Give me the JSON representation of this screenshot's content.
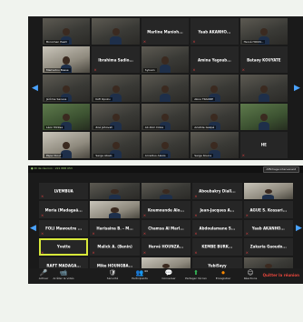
{
  "top_grid": [
    {
      "name": "Bonomen Pesih",
      "style": "video"
    },
    {
      "name": "",
      "style": "video"
    },
    {
      "name": "Marline  Manioh...",
      "style": "blank"
    },
    {
      "name": "Yaab AKANHO...",
      "style": "blank"
    },
    {
      "name": "Hervé HOUN...",
      "style": "video"
    },
    {
      "name": "Mamadou Basse",
      "style": "video light"
    },
    {
      "name": "Ibrahima  Sadio...",
      "style": "blank"
    },
    {
      "name": "Sylvain",
      "style": "video"
    },
    {
      "name": "Amina  Yagoub...",
      "style": "blank"
    },
    {
      "name": "Bataoy KOUYATE",
      "style": "blank"
    },
    {
      "name": "Jérôme Sansoa",
      "style": "video"
    },
    {
      "name": "Kofi Opoku",
      "style": "video"
    },
    {
      "name": "",
      "style": "video"
    },
    {
      "name": "Abou TRAORE",
      "style": "video"
    },
    {
      "name": "",
      "style": "video"
    },
    {
      "name": "Léon Mintsa",
      "style": "video green"
    },
    {
      "name": "Zoé Jéhovah",
      "style": "video"
    },
    {
      "name": "Ali Ahm Doka",
      "style": "video"
    },
    {
      "name": "Aristide Gakpé",
      "style": "video"
    },
    {
      "name": "",
      "style": "video green"
    },
    {
      "name": "Papa Diouf",
      "style": "video light"
    },
    {
      "name": "Serge Abalo",
      "style": "video"
    },
    {
      "name": "Arcadius Alexis",
      "style": "video"
    },
    {
      "name": "Serge Kouna",
      "style": "video"
    },
    {
      "name": "HE",
      "style": "blank"
    }
  ],
  "bottom_strip": {
    "info": "● ID de réunion : 221 888 053",
    "view_button": "Affichage intervenant"
  },
  "bottom_grid": [
    {
      "name": "LVEMBUA",
      "style": "blank"
    },
    {
      "name": "",
      "style": "video"
    },
    {
      "name": "",
      "style": "video"
    },
    {
      "name": "Aboubakry  Diall...",
      "style": "blank"
    },
    {
      "name": "",
      "style": "video light"
    },
    {
      "name": "Moria  (Madagaâ...",
      "style": "blank"
    },
    {
      "name": "",
      "style": "video light"
    },
    {
      "name": "Koumounde  Alo...",
      "style": "blank"
    },
    {
      "name": "Jean-Jacques  A...",
      "style": "blank"
    },
    {
      "name": "AGUE S.  Kossari...",
      "style": "blank"
    },
    {
      "name": "FOLI  Mawoutre ...",
      "style": "blank"
    },
    {
      "name": "Harisaina  B. - M...",
      "style": "blank"
    },
    {
      "name": "Chamsa  Al  Marl...",
      "style": "blank"
    },
    {
      "name": "Abdoulamane  S...",
      "style": "blank"
    },
    {
      "name": "Yaab  AKANHO...",
      "style": "blank"
    },
    {
      "name": "Yvette",
      "style": "blank active"
    },
    {
      "name": "Malick  A. (Benin)",
      "style": "blank"
    },
    {
      "name": "Hervé  HOUNZA...",
      "style": "blank"
    },
    {
      "name": "KEMBE  BURK...",
      "style": "blank"
    },
    {
      "name": "Zakaria  Gaoudo...",
      "style": "blank"
    },
    {
      "name": "RAFT  MADAGA...",
      "style": "blank"
    },
    {
      "name": "Mike  HOUNGBA...",
      "style": "blank"
    },
    {
      "name": "",
      "style": "video light"
    },
    {
      "name": "YubiSayy",
      "style": "blank"
    },
    {
      "name": "",
      "style": "video"
    }
  ],
  "toolbar": {
    "items": [
      {
        "icon": "🎤",
        "label": "Activer",
        "name": "microphone-icon"
      },
      {
        "icon": "📹",
        "label": "Arrêter la vidéo",
        "name": "video-camera-icon"
      },
      {
        "icon": "🛡",
        "label": "Sécurité",
        "name": "shield-icon"
      },
      {
        "icon": "👥",
        "label": "Participants",
        "name": "participants-icon"
      },
      {
        "icon": "💬",
        "label": "Converser",
        "name": "chat-icon"
      },
      {
        "icon": "⬆",
        "label": "Partager l'écran",
        "name": "share-screen-icon"
      },
      {
        "icon": "⏺",
        "label": "Enregistrer",
        "name": "record-icon"
      },
      {
        "icon": "☺",
        "label": "Réactions",
        "name": "reactions-icon"
      }
    ],
    "end_label": "Quitter la réunion",
    "participant_count": "44"
  }
}
